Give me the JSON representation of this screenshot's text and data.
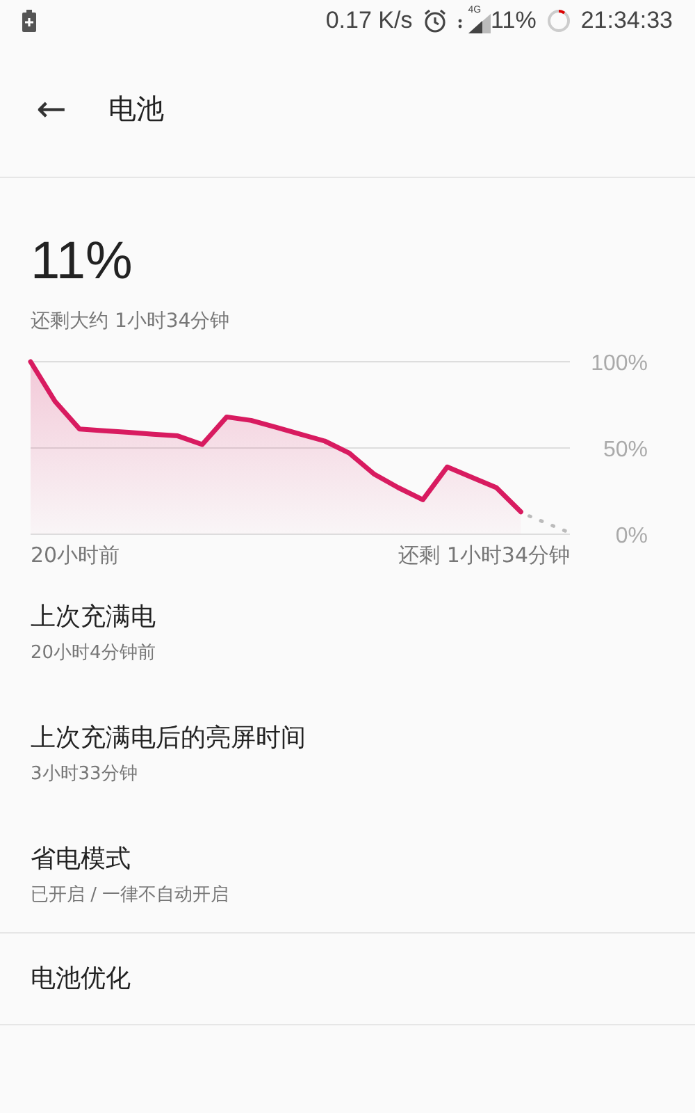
{
  "status_bar": {
    "speed": "0.17 K/s",
    "network": "4G",
    "battery": "11%",
    "time": "21:34:33"
  },
  "header": {
    "back": "←",
    "title": "电池"
  },
  "battery": {
    "percent": "11%",
    "remaining": "还剩大约 1小时34分钟"
  },
  "chart_data": {
    "type": "area",
    "yticks": [
      {
        "value": 100,
        "label": "100%"
      },
      {
        "value": 50,
        "label": "50%"
      },
      {
        "value": 0,
        "label": "0%"
      }
    ],
    "ylim": [
      0,
      100
    ],
    "categories": [
      null,
      null,
      null,
      null,
      null,
      null,
      null,
      null,
      null,
      null,
      null,
      null,
      null,
      null,
      null,
      null,
      null,
      null,
      null,
      null,
      null,
      null,
      null
    ],
    "series": [
      {
        "color": "#d81b60",
        "values": [
          100,
          77,
          61,
          60,
          59,
          58,
          57,
          52,
          68,
          66,
          62,
          58,
          54,
          47,
          35,
          27,
          20,
          39,
          33,
          27,
          13,
          null,
          null
        ]
      }
    ]
  },
  "chart_labels": {
    "start": "20小时前",
    "end": "还剩 1小时34分钟"
  },
  "items": [
    {
      "title": "上次充满电",
      "subtitle": "20小时4分钟前"
    },
    {
      "title": "上次充满电后的亮屏时间",
      "subtitle": "3小时33分钟"
    },
    {
      "title": "省电模式",
      "subtitle": "已开启 / 一律不自动开启"
    },
    {
      "title": "电池优化"
    }
  ]
}
